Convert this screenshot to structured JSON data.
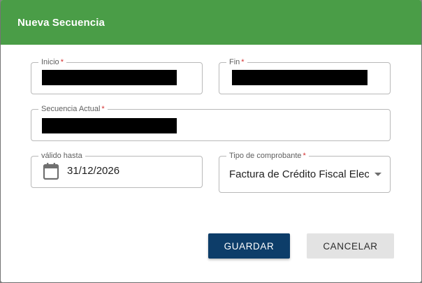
{
  "dialog": {
    "title": "Nueva Secuencia",
    "header_color": "#4a9d47"
  },
  "fields": {
    "inicio": {
      "label": "Inicio",
      "required_mark": "*",
      "value_redacted": true
    },
    "fin": {
      "label": "Fin",
      "required_mark": "*",
      "value_redacted": true
    },
    "secuencia_actual": {
      "label": "Secuencia Actual",
      "required_mark": "*",
      "value_redacted": true
    },
    "valido_hasta": {
      "label": "válido hasta",
      "value": "31/12/2026",
      "icon": "calendar-icon"
    },
    "tipo_comprobante": {
      "label": "Tipo de comprobante",
      "required_mark": "*",
      "value": "Factura de Crédito Fiscal Elec",
      "icon": "chevron-down-icon"
    }
  },
  "buttons": {
    "save_label": "GUARDAR",
    "cancel_label": "CANCELAR",
    "primary_color": "#0d3d69"
  }
}
